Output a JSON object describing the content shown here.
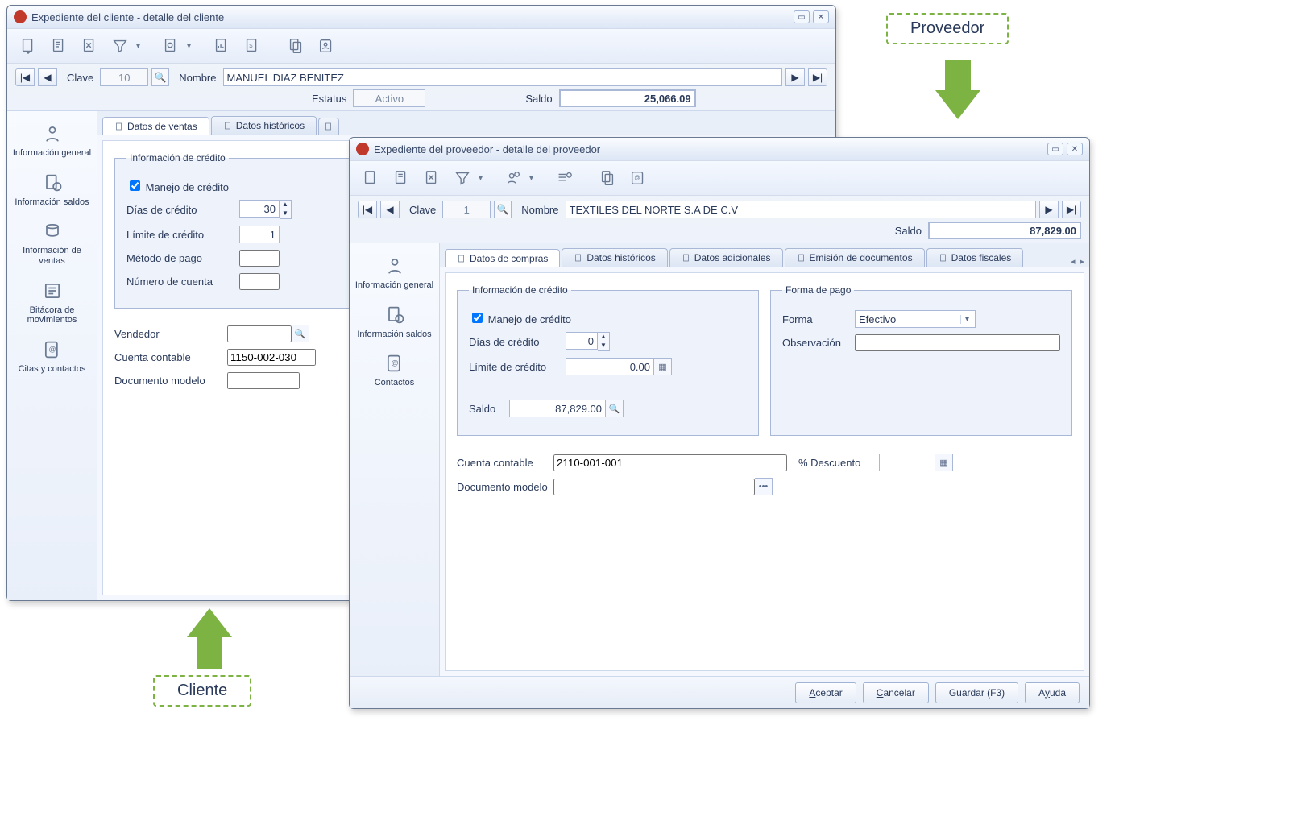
{
  "annotations": {
    "cliente_label": "Cliente",
    "proveedor_label": "Proveedor"
  },
  "cliente": {
    "title": "Expediente del cliente - detalle del cliente",
    "clave_label": "Clave",
    "clave": "10",
    "nombre_label": "Nombre",
    "nombre": "MANUEL DIAZ BENITEZ",
    "estatus_label": "Estatus",
    "estatus": "Activo",
    "saldo_label": "Saldo",
    "saldo": "25,066.09",
    "side": [
      "Información general",
      "Información saldos",
      "Información de ventas",
      "Bitácora de movimientos",
      "Citas y contactos"
    ],
    "tabs": [
      "Datos de ventas",
      "Datos históricos"
    ],
    "credit_legend": "Información de crédito",
    "manejo_label": "Manejo de crédito",
    "manejo": true,
    "dias_label": "Días de crédito",
    "dias": "30",
    "limite_label": "Límite de crédito",
    "limite": "1",
    "metodo_label": "Método de pago",
    "numcta_label": "Número de cuenta",
    "vendedor_label": "Vendedor",
    "cuenta_label": "Cuenta contable",
    "cuenta": "1150-002-030",
    "docmodelo_label": "Documento modelo"
  },
  "proveedor": {
    "title": "Expediente del proveedor - detalle del proveedor",
    "clave_label": "Clave",
    "clave": "1",
    "nombre_label": "Nombre",
    "nombre": "TEXTILES DEL NORTE S.A DE C.V",
    "saldo_label": "Saldo",
    "saldo": "87,829.00",
    "side": [
      "Información general",
      "Información saldos",
      "Contactos"
    ],
    "tabs": [
      "Datos de compras",
      "Datos históricos",
      "Datos adicionales",
      "Emisión de documentos",
      "Datos fiscales"
    ],
    "credit_legend": "Información de crédito",
    "manejo_label": "Manejo de crédito",
    "manejo": true,
    "dias_label": "Días de crédito",
    "dias": "0",
    "limite_label": "Límite de crédito",
    "limite": "0.00",
    "saldo2_label": "Saldo",
    "saldo2": "87,829.00",
    "forma_legend": "Forma de pago",
    "forma_label": "Forma",
    "forma": "Efectivo",
    "obs_label": "Observación",
    "cuenta_label": "Cuenta contable",
    "cuenta": "2110-001-001",
    "desc_label": "% Descuento",
    "docmodelo_label": "Documento modelo",
    "buttons": {
      "aceptar": "Aceptar",
      "cancelar": "Cancelar",
      "guardar": "Guardar (F3)",
      "ayuda": "Ayuda"
    }
  }
}
